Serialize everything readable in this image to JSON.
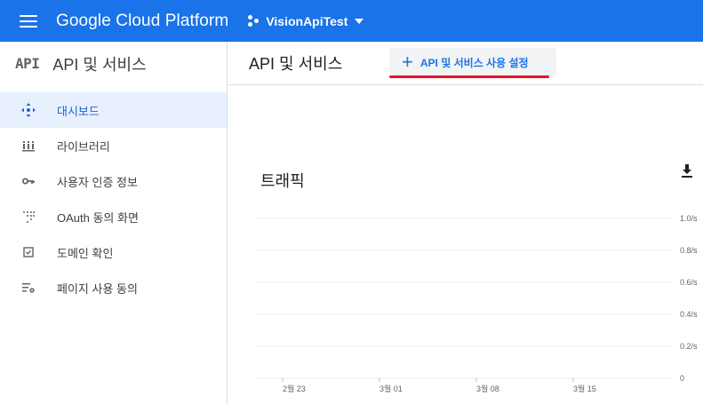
{
  "topbar": {
    "brand": "Google Cloud Platform",
    "project": "VisionApiTest",
    "color": "#1a73e8"
  },
  "sidebar": {
    "logo": "API",
    "title": "API 및 서비스",
    "items": [
      {
        "label": "대시보드",
        "icon": "dashboard-icon",
        "active": true
      },
      {
        "label": "라이브러리",
        "icon": "library-icon"
      },
      {
        "label": "사용자 인증 정보",
        "icon": "key-icon"
      },
      {
        "label": "OAuth 동의 화면",
        "icon": "oauth-dots-icon"
      },
      {
        "label": "도메인 확인",
        "icon": "checkbox-icon"
      },
      {
        "label": "페이지 사용 동의",
        "icon": "settings-list-icon"
      }
    ]
  },
  "main": {
    "title": "API 및 서비스",
    "enable_button": "API 및 서비스 사용 설정",
    "highlight_color": "#e8112d"
  },
  "traffic": {
    "title": "트래픽"
  },
  "chart_data": {
    "type": "line",
    "title": "트래픽",
    "x_ticks": [
      "2월 23",
      "3월 01",
      "3월 08",
      "3월 15"
    ],
    "y_ticks": [
      "1.0/s",
      "0.8/s",
      "0.6/s",
      "0.4/s",
      "0.2/s",
      "0"
    ],
    "ylim": [
      0,
      1.0
    ],
    "grid": true,
    "series": []
  }
}
